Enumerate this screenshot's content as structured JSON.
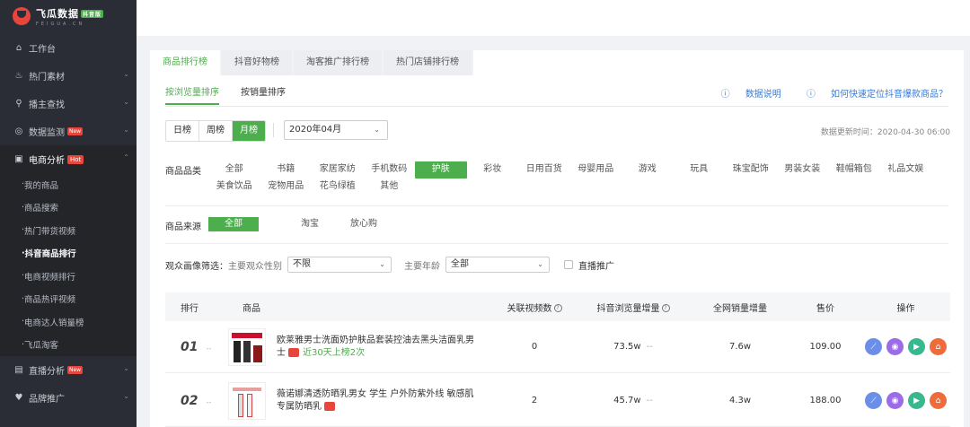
{
  "brand": {
    "name": "飞瓜数据",
    "badge": "抖音版",
    "subtitle": "FEIGUA.CN"
  },
  "sidebar": {
    "items": [
      {
        "label": "工作台",
        "icon": "home-icon"
      },
      {
        "label": "热门素材",
        "icon": "fire-icon"
      },
      {
        "label": "播主查找",
        "icon": "search-icon"
      },
      {
        "label": "数据监测",
        "icon": "monitor-icon",
        "badge": "New"
      },
      {
        "label": "电商分析",
        "icon": "shop-icon",
        "badge": "Hot"
      }
    ],
    "subitems": [
      "我的商品",
      "商品搜索",
      "热门带货视频",
      "抖音商品排行",
      "电商视频排行",
      "商品热评视频",
      "电商达人销量榜",
      "飞瓜淘客"
    ],
    "bottom": [
      {
        "label": "直播分析",
        "icon": "live-icon",
        "badge": "New"
      },
      {
        "label": "品牌推广",
        "icon": "brand-icon"
      }
    ]
  },
  "tabs": [
    "商品排行榜",
    "抖音好物榜",
    "淘客推广排行榜",
    "热门店铺排行榜"
  ],
  "subtabs": [
    "按浏览量排序",
    "按销量排序"
  ],
  "help": [
    "数据说明",
    "如何快速定位抖音爆款商品？"
  ],
  "period": [
    "日榜",
    "周榜",
    "月榜"
  ],
  "month": "2020年04月",
  "update_time": "数据更新时间：2020-04-30 06:00",
  "category_label": "商品品类",
  "categories": [
    "全部",
    "书籍",
    "家居家纺",
    "手机数码",
    "护肤",
    "彩妆",
    "日用百货",
    "母婴用品",
    "游戏",
    "玩具",
    "珠宝配饰",
    "男装女装",
    "鞋帽箱包",
    "礼品文娱",
    "美食饮品",
    "宠物用品",
    "花鸟绿植",
    "其他"
  ],
  "source_label": "商品来源",
  "sources": [
    "全部",
    "淘宝",
    "放心购"
  ],
  "audience": {
    "label": "观众画像筛选：",
    "gender_label": "主要观众性别",
    "gender_value": "不限",
    "age_label": "主要年龄",
    "age_value": "全部",
    "live_label": "直播推广"
  },
  "table": {
    "headers": [
      "排行",
      "商品",
      "关联视频数",
      "抖音浏览量增量",
      "全网销量增量",
      "售价",
      "操作"
    ],
    "rows": [
      {
        "rank": "01",
        "rank_change": "--",
        "name": "欧莱雅男士洗面奶护肤品套装控油去黑头洁面乳男士",
        "note": "近30天上榜2次",
        "videos": "0",
        "views": "73.5w",
        "views_change": "--",
        "sales": "7.6w",
        "price": "109.00"
      },
      {
        "rank": "02",
        "rank_change": "--",
        "name": "薇诺娜清透防晒乳男女 学生 户外防紫外线 敏感肌专属防晒乳",
        "videos": "2",
        "views": "45.7w",
        "views_change": "--",
        "sales": "4.3w",
        "price": "188.00"
      }
    ]
  }
}
